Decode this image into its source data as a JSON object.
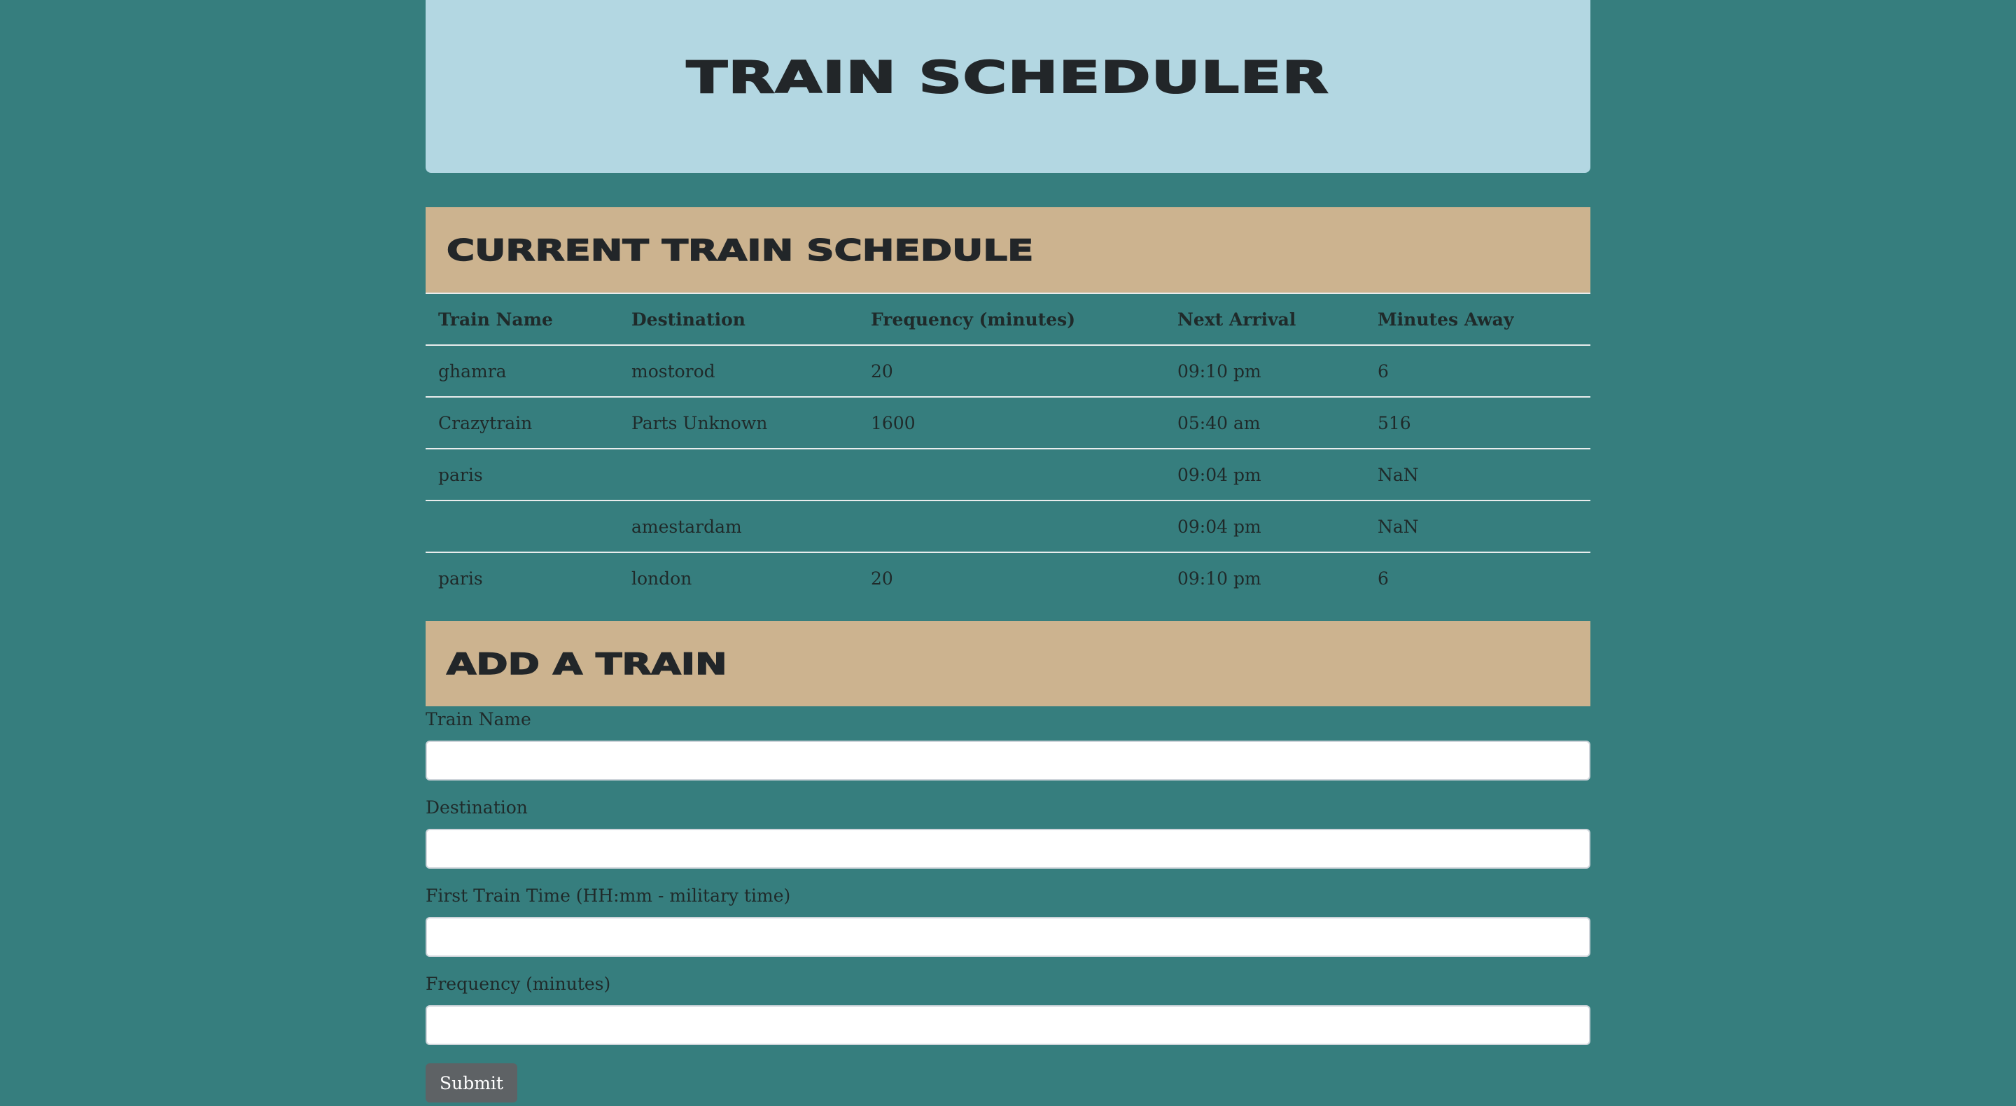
{
  "header": {
    "title": "TRAIN SCHEDULER"
  },
  "schedule": {
    "heading": "CURRENT TRAIN SCHEDULE",
    "columns": [
      "Train Name",
      "Destination",
      "Frequency (minutes)",
      "Next Arrival",
      "Minutes Away"
    ],
    "rows": [
      [
        "ghamra",
        "mostorod",
        "20",
        "09:10 pm",
        "6"
      ],
      [
        "Crazytrain",
        "Parts Unknown",
        "1600",
        "05:40 am",
        "516"
      ],
      [
        "paris",
        "",
        "",
        "09:04 pm",
        "NaN"
      ],
      [
        "",
        "amestardam",
        "",
        "09:04 pm",
        "NaN"
      ],
      [
        "paris",
        "london",
        "20",
        "09:10 pm",
        "6"
      ]
    ]
  },
  "form": {
    "heading": "ADD A TRAIN",
    "fields": [
      {
        "label": "Train Name",
        "value": "",
        "placeholder": ""
      },
      {
        "label": "Destination",
        "value": "",
        "placeholder": ""
      },
      {
        "label": "First Train Time (HH:mm - military time)",
        "value": "",
        "placeholder": ""
      },
      {
        "label": "Frequency (minutes)",
        "value": "",
        "placeholder": ""
      }
    ],
    "submit_label": "Submit"
  },
  "colors": {
    "page_background": "#367e7e",
    "header_background": "#b3d7e2",
    "section_heading_background": "#ccb38f",
    "button_background": "#5e6265"
  }
}
